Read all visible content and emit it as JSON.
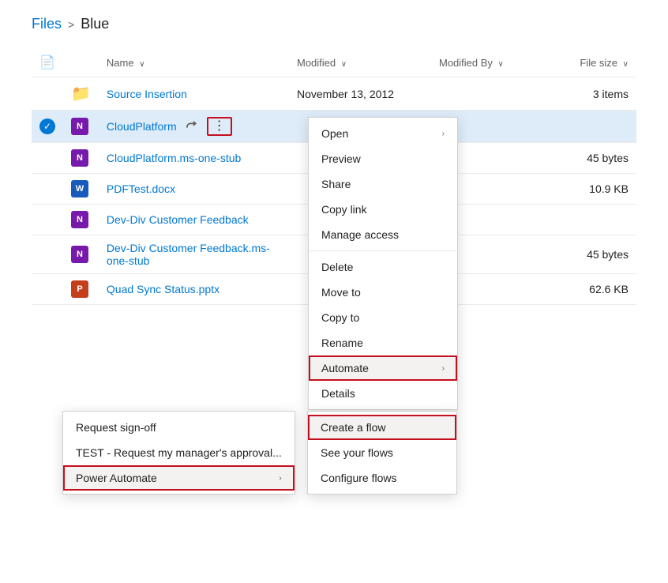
{
  "breadcrumb": {
    "root": "Files",
    "separator": ">",
    "current": "Blue"
  },
  "table": {
    "columns": [
      {
        "id": "checkbox",
        "label": ""
      },
      {
        "id": "icon",
        "label": ""
      },
      {
        "id": "name",
        "label": "Name",
        "sortable": true
      },
      {
        "id": "modified",
        "label": "Modified",
        "sortable": true
      },
      {
        "id": "modifiedby",
        "label": "Modified By",
        "sortable": true
      },
      {
        "id": "filesize",
        "label": "File size",
        "sortable": true
      }
    ],
    "rows": [
      {
        "id": "row-source",
        "selected": false,
        "icon": "folder",
        "name": "Source Insertion",
        "modified": "November 13, 2012",
        "modifiedBy": "",
        "fileSize": "3 items"
      },
      {
        "id": "row-cloudplatform",
        "selected": true,
        "icon": "onenote",
        "name": "CloudPlatform",
        "modified": "",
        "modifiedBy": "",
        "fileSize": ""
      },
      {
        "id": "row-cloudplatform-stub",
        "selected": false,
        "icon": "onenote",
        "name": "CloudPlatform.ms-one-stub",
        "modified": "",
        "modifiedBy": "",
        "fileSize": "45 bytes"
      },
      {
        "id": "row-pdftest",
        "selected": false,
        "icon": "word",
        "name": "PDFTest.docx",
        "modified": "",
        "modifiedBy": "",
        "fileSize": "10.9 KB"
      },
      {
        "id": "row-devdiv",
        "selected": false,
        "icon": "onenote",
        "name": "Dev-Div Customer Feedback",
        "modified": "",
        "modifiedBy": "",
        "fileSize": ""
      },
      {
        "id": "row-devdiv-stub",
        "selected": false,
        "icon": "onenote",
        "name": "Dev-Div Customer Feedback.ms-one-stub",
        "modified": "",
        "modifiedBy": "",
        "fileSize": "45 bytes"
      },
      {
        "id": "row-quadsync",
        "selected": false,
        "icon": "powerpoint",
        "name": "Quad Sync Status.pptx",
        "modified": "",
        "modifiedBy": "",
        "fileSize": "62.6 KB"
      }
    ]
  },
  "context_menu": {
    "items": [
      {
        "id": "open",
        "label": "Open",
        "has_submenu": true
      },
      {
        "id": "preview",
        "label": "Preview",
        "has_submenu": false
      },
      {
        "id": "share",
        "label": "Share",
        "has_submenu": false
      },
      {
        "id": "copy_link",
        "label": "Copy link",
        "has_submenu": false
      },
      {
        "id": "manage_access",
        "label": "Manage access",
        "has_submenu": false
      },
      {
        "id": "delete",
        "label": "Delete",
        "has_submenu": false
      },
      {
        "id": "move_to",
        "label": "Move to",
        "has_submenu": false
      },
      {
        "id": "copy_to",
        "label": "Copy to",
        "has_submenu": false
      },
      {
        "id": "rename",
        "label": "Rename",
        "has_submenu": false
      },
      {
        "id": "automate",
        "label": "Automate",
        "has_submenu": true,
        "highlighted": true
      },
      {
        "id": "details",
        "label": "Details",
        "has_submenu": false
      }
    ]
  },
  "sub_menu": {
    "items": [
      {
        "id": "request-signoff",
        "label": "Request sign-off"
      },
      {
        "id": "test-request",
        "label": "TEST - Request my manager's approval..."
      },
      {
        "id": "power-automate",
        "label": "Power Automate",
        "has_submenu": true,
        "highlighted": true
      }
    ]
  },
  "automate_submenu": {
    "items": [
      {
        "id": "create-flow",
        "label": "Create a flow",
        "highlighted": true
      },
      {
        "id": "see-flows",
        "label": "See your flows"
      },
      {
        "id": "configure-flows",
        "label": "Configure flows"
      }
    ]
  }
}
